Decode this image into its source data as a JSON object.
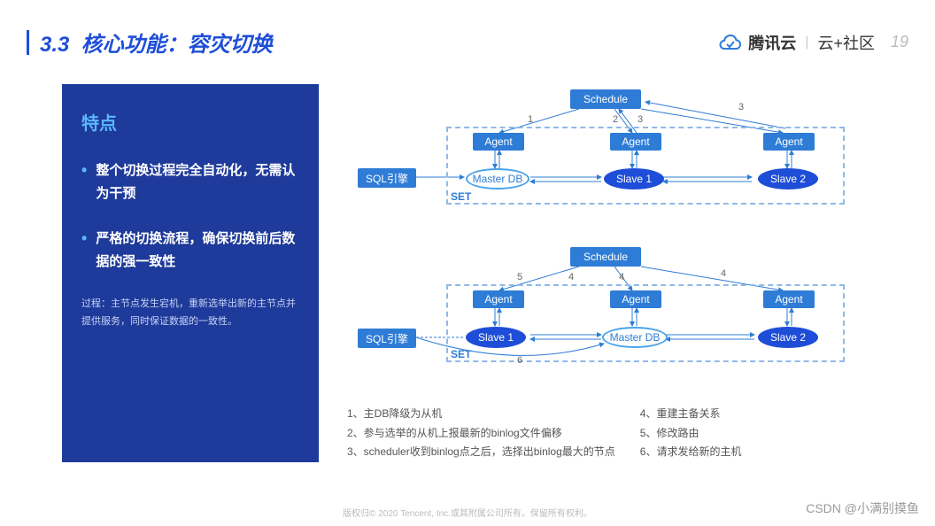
{
  "header": {
    "section_num": "3.3",
    "section_title": "核心功能：容灾切换",
    "logo_text": "腾讯云",
    "community": "云+社区",
    "page_num": "19"
  },
  "left_panel": {
    "title": "特点",
    "bullets": [
      "整个切换过程完全自动化，无需认为干预",
      "严格的切换流程，确保切换前后数据的强一致性"
    ],
    "process": "过程：主节点发生宕机，重新选举出新的主节点并提供服务，同时保证数据的一致性。"
  },
  "diagram": {
    "schedule": "Schedule",
    "agent": "Agent",
    "sql_engine": "SQL引擎",
    "master_db": "Master DB",
    "slave1": "Slave 1",
    "slave2": "Slave 2",
    "set": "SET",
    "top_nums": {
      "n1": "1",
      "n2": "2",
      "n3": "3"
    },
    "bot_nums": {
      "n4": "4",
      "n5": "5",
      "n6": "6"
    }
  },
  "steps": {
    "left": [
      "1、主DB降级为从机",
      "2、参与选举的从机上报最新的binlog文件偏移",
      "3、scheduler收到binlog点之后，选择出binlog最大的节点"
    ],
    "right": [
      "4、重建主备关系",
      "5、修改路由",
      "6、请求发给新的主机"
    ]
  },
  "footer": "版权归© 2020 Tencent, Inc.或其附属公司所有。保留所有权利。",
  "watermark": "CSDN @小满别摸鱼"
}
